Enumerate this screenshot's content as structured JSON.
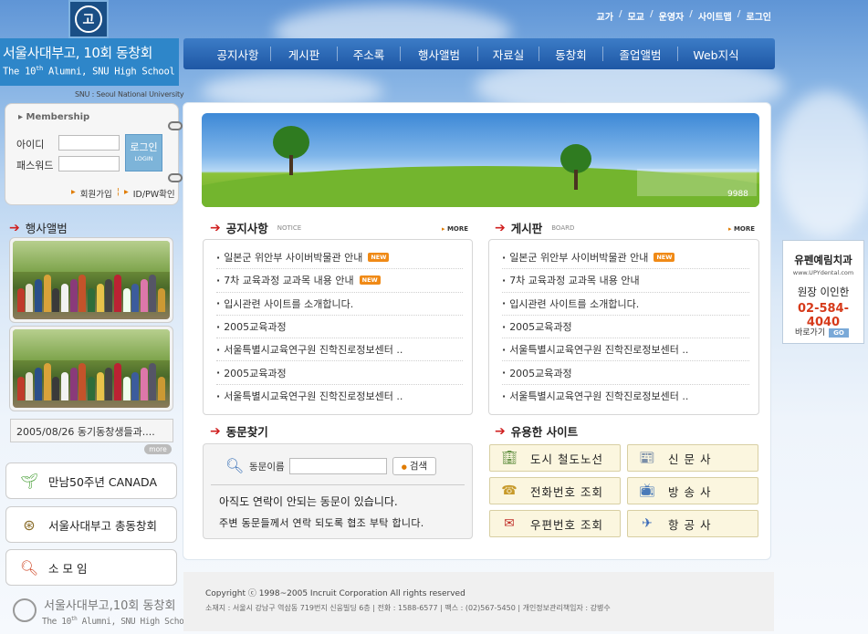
{
  "header": {
    "title": "서울사대부고, 10회 동창회",
    "subtitle_pre": "The 10",
    "subtitle_sup": "th",
    "subtitle_post": " Alumni, SNU High School",
    "snu": "SNU : Seoul National University",
    "emblem_char": "고",
    "util_links": [
      "교가",
      "모교",
      "운영자",
      "사이트맵",
      "로그인"
    ],
    "util_sep": "/"
  },
  "gnb": [
    "공지사항",
    "게시판",
    "주소록",
    "행사앨범",
    "자료실",
    "동창회",
    "졸업앨범",
    "Web지식"
  ],
  "login": {
    "heading": "Membership",
    "id_label": "아이디",
    "pw_label": "패스워드",
    "id_value": "",
    "pw_value": "",
    "btn_label": "로그인",
    "btn_sub": "LOGIN",
    "join": "회원가입",
    "find": "ID/PW확인"
  },
  "album": {
    "heading": "행사앨범",
    "caption": "2005/08/26 동기동창생들과....",
    "more": "more"
  },
  "quick_links": [
    {
      "label": "만남50주년 CANADA",
      "icon": "plant-icon"
    },
    {
      "label": "서울사대부고 총동창회",
      "icon": "emblem-icon"
    },
    {
      "label": "소 모 임",
      "icon": "magnifier-icon"
    }
  ],
  "foot_logo": {
    "line1": "서울사대부고,10회 동창회",
    "line2_pre": "The 10",
    "line2_sup": "th",
    "line2_post": " Alumni, SNU High School"
  },
  "banner": {
    "number": "9988"
  },
  "notice": {
    "title": "공지사항",
    "en": "NOTICE",
    "more": "MORE",
    "items": [
      {
        "text": "일본군 위안부 사이버박물관 안내",
        "new": true
      },
      {
        "text": "7차 교육과정 교과목 내용 안내",
        "new": true
      },
      {
        "text": "입시관련 사이트를 소개합니다.",
        "new": false
      },
      {
        "text": "2005교육과정",
        "new": false
      },
      {
        "text": "서울특별시교육연구원 진학진로정보센터  ..",
        "new": false
      },
      {
        "text": "2005교육과정",
        "new": false
      },
      {
        "text": "서울특별시교육연구원 진학진로정보센터  ..",
        "new": false
      }
    ]
  },
  "board": {
    "title": "게시판",
    "en": "BOARD",
    "more": "MORE",
    "items": [
      {
        "text": "일본군 위안부 사이버박물관 안내",
        "new": true
      },
      {
        "text": "7차 교육과정 교과목 내용 안내",
        "new": false
      },
      {
        "text": "입시관련 사이트를 소개합니다.",
        "new": false
      },
      {
        "text": "2005교육과정",
        "new": false
      },
      {
        "text": "서울특별시교육연구원 진학진로정보센터  ..",
        "new": false
      },
      {
        "text": "2005교육과정",
        "new": false
      },
      {
        "text": "서울특별시교육연구원 진학진로정보센터  ..",
        "new": false
      }
    ]
  },
  "new_badge": "NEW",
  "find": {
    "title": "동문찾기",
    "label": "동문이름",
    "value": "",
    "button": "검색",
    "msg1": "아직도 연락이 안되는 동문이 있습니다.",
    "msg2": "주변 동문들께서 연락 되도록 협조 부탁 합니다."
  },
  "sites": {
    "title": "유용한 사이트",
    "items": [
      {
        "label": "도시 철도노선",
        "icon": "building-icon"
      },
      {
        "label": "신 문 사",
        "icon": "newspaper-icon"
      },
      {
        "label": "전화번호 조회",
        "icon": "phone-icon"
      },
      {
        "label": "방 송 사",
        "icon": "broadcast-icon"
      },
      {
        "label": "우편번호 조회",
        "icon": "mail-icon"
      },
      {
        "label": "항 공 사",
        "icon": "airplane-icon"
      }
    ]
  },
  "footer": {
    "copyright": "Copyright ⓒ 1998~2005 Incruit Corporation All rights reserved",
    "address": "소재지 : 서울시 강남구 역삼동 719번지 신웅빌딩 6층 | 전화 : 1588-6577 | 팩스 : (02)567-5450 | 개인정보관리책임자 : 강병수"
  },
  "ad": {
    "name": "유펜예림치과",
    "url": "www.UPYdental.com",
    "doctor": "원장 이인한",
    "phone": "02-584-4040",
    "go": "바로가기",
    "go_btn": "GO"
  },
  "colors": {
    "accent_red": "#d02020",
    "nav_blue": "#1e57a5",
    "badge_orange": "#f08a16"
  }
}
